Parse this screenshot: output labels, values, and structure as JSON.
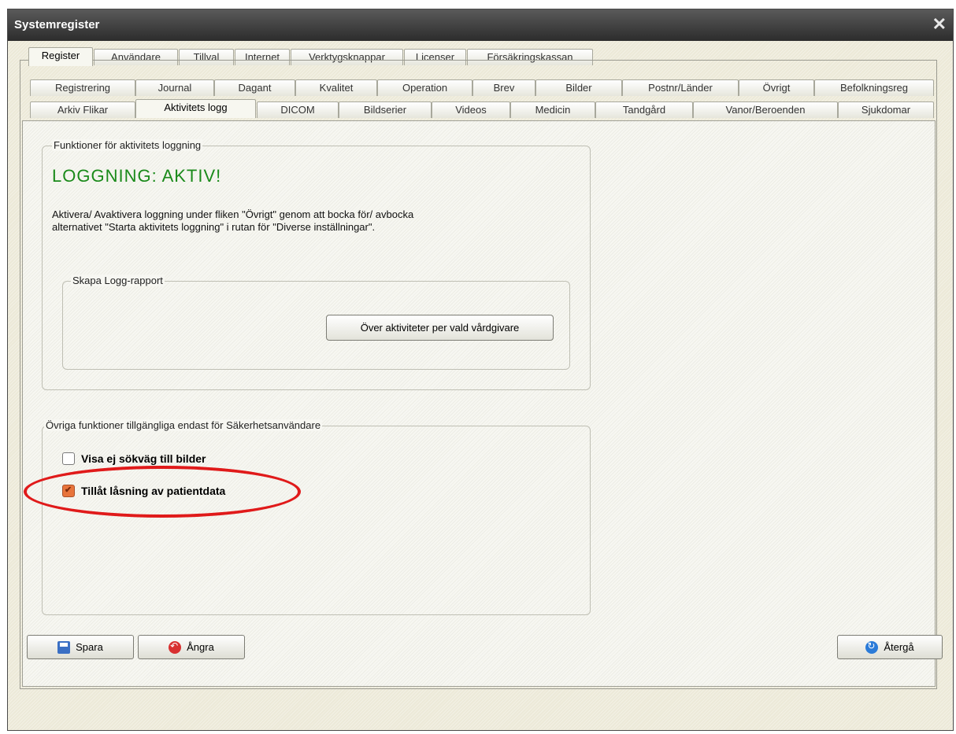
{
  "window": {
    "title": "Systemregister",
    "close_icon": "close-icon"
  },
  "top_tabs": [
    "Register",
    "Användare",
    "Tillval",
    "Internet",
    "Verktygsknappar",
    "Licenser",
    "Försäkringskassan"
  ],
  "tabs_row1": [
    "Registrering",
    "Journal",
    "Dagant",
    "Kvalitet",
    "Operation",
    "Brev",
    "Bilder",
    "Postnr/Länder",
    "Övrigt",
    "Befolkningsreg"
  ],
  "tabs_row2": [
    "Arkiv Flikar",
    "Aktivitets logg",
    "DICOM",
    "Bildserier",
    "Videos",
    "Medicin",
    "Tandgård",
    "Vanor/Beroenden",
    "Sjukdomar"
  ],
  "activity_group": {
    "legend": "Funktioner för aktivitets loggning",
    "status": "LOGGNING: AKTIV!",
    "line1": "Aktivera/ Avaktivera loggning under fliken \"Övrigt\" genom att bocka för/ avbocka",
    "line2": "alternativet \"Starta aktivitets loggning\" i rutan för \"Diverse inställningar\".",
    "report_legend": "Skapa Logg-rapport",
    "report_button": "Över aktiviteter per vald vårdgivare"
  },
  "security_group": {
    "legend": "Övriga funktioner tillgängliga endast för Säkerhetsanvändare",
    "option1": "Visa ej sökväg till bilder",
    "option1_checked": false,
    "option2": "Tillåt låsning av patientdata",
    "option2_checked": true
  },
  "bottom": {
    "save": "Spara",
    "undo": "Ångra",
    "back": "Återgå"
  },
  "colors": {
    "status_green": "#1a8a1a",
    "highlight_red": "#e01a1a",
    "checkbox_orange": "#e8743b"
  }
}
